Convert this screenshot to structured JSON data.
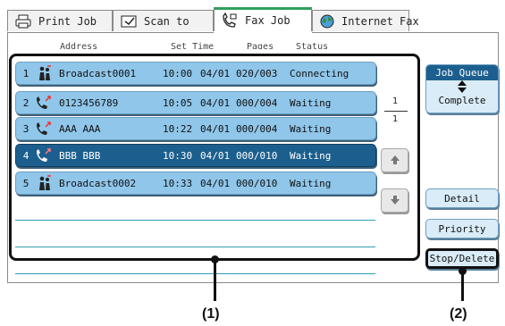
{
  "tabs": [
    {
      "label": "Print Job",
      "icon": "printer-icon",
      "active": false
    },
    {
      "label": "Scan to",
      "icon": "scanner-icon",
      "active": false
    },
    {
      "label": "Fax Job",
      "icon": "fax-phone-icon",
      "active": true
    },
    {
      "label": "Internet Fax",
      "icon": "globe-icon",
      "active": false
    }
  ],
  "columns": {
    "address": "Address",
    "set_time": "Set Time",
    "pages": "Pages",
    "status": "Status"
  },
  "jobs": [
    {
      "num": "1",
      "icon": "broadcast-icon",
      "address": "Broadcast0001",
      "time": "10:00",
      "date": "04/01",
      "pages": "020/003",
      "status": "Connecting",
      "selected": false
    },
    {
      "num": "2",
      "icon": "fax-send-icon",
      "address": "0123456789",
      "time": "10:05",
      "date": "04/01",
      "pages": "000/004",
      "status": "Waiting",
      "selected": false
    },
    {
      "num": "3",
      "icon": "fax-send-icon",
      "address": "AAA AAA",
      "time": "10:22",
      "date": "04/01",
      "pages": "000/004",
      "status": "Waiting",
      "selected": false
    },
    {
      "num": "4",
      "icon": "fax-send-icon",
      "address": "BBB BBB",
      "time": "10:30",
      "date": "04/01",
      "pages": "000/010",
      "status": "Waiting",
      "selected": true
    },
    {
      "num": "5",
      "icon": "broadcast-icon",
      "address": "Broadcast0002",
      "time": "10:33",
      "date": "04/01",
      "pages": "000/010",
      "status": "Waiting",
      "selected": false
    }
  ],
  "pager": {
    "current": "1",
    "total": "1"
  },
  "job_queue": {
    "top": "Job Queue",
    "bottom": "Complete"
  },
  "buttons": {
    "detail": "Detail",
    "priority": "Priority",
    "stop_delete": "Stop/Delete"
  },
  "callouts": {
    "list": "(1)",
    "buttons": "(2)"
  },
  "colors": {
    "row": "#8fc6ea",
    "row_selected": "#1c5f8e",
    "tab_active_accent": "#2f9f5d",
    "button_bg": "#d9ecf8"
  }
}
